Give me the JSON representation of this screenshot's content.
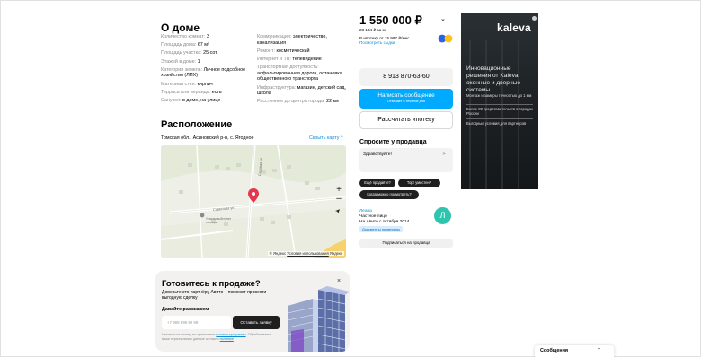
{
  "about": {
    "title": "О доме",
    "left_params": [
      {
        "k": "Количество комнат:",
        "v": "3"
      },
      {
        "k": "Площадь дома:",
        "v": "67 м²"
      },
      {
        "k": "Площадь участка:",
        "v": "25 сот."
      },
      {
        "k": "Этажей в доме:",
        "v": "1"
      },
      {
        "k": "Категория земель:",
        "v": "Личное подсобное хозяйство (ЛПХ)"
      },
      {
        "k": "Материал стен:",
        "v": "кирпич"
      },
      {
        "k": "Терраса или веранда:",
        "v": "есть"
      },
      {
        "k": "Санузел:",
        "v": "в доме, на улице"
      }
    ],
    "right_params": [
      {
        "k": "Коммуникации:",
        "v": "электричество, канализация"
      },
      {
        "k": "Ремонт:",
        "v": "косметический"
      },
      {
        "k": "Интернет и ТВ:",
        "v": "телевидение"
      },
      {
        "k": "Транспортная доступность:",
        "v": "асфальтированная дорога, остановка общественного транспорта"
      },
      {
        "k": "Инфраструктура:",
        "v": "магазин, детский сад, школа"
      },
      {
        "k": "Расстояние до центра города:",
        "v": "22 км"
      }
    ]
  },
  "location": {
    "title": "Расположение",
    "address": "Томская обл., Асиновский р-н, с. Ягодное",
    "hide_map": "Скрыть карту ^",
    "map_labels": {
      "street1": "Садовая ул.",
      "street2": "Советская ул.",
      "poi": "Участковый пункт полиции"
    },
    "zoom_in": "+",
    "zoom_out": "–",
    "locate": "➤",
    "footer_brand": "© Яндекс",
    "footer_terms": "Условия использования",
    "footer_logo": "Яндекс"
  },
  "promo": {
    "title": "Готовитесь к продаже?",
    "subtitle": "Доверьте это партнёру Авито – поможет провести выгодную сделку",
    "question": "Давайте расскажем",
    "phone_placeholder": "+7 999 999 99 99",
    "button": "Оставить заявку",
    "legal_prefix": "Нажимая на кнопку, вы принимаете ",
    "legal_link1": "условия программы",
    "legal_mid": ". Обрабатываем ваши персональные данные согласно ",
    "legal_link2": "политике",
    "close": "×"
  },
  "offer": {
    "price": "1 550 000 ₽",
    "price_chevron": "⌄",
    "per_m2": "23 134 ₽ за м²",
    "mortgage": "В ипотеку от 15 997 ₽/мес",
    "show_offers": "Посмотреть сыдки",
    "phone": "8 913 870-63-60",
    "write_l1": "Написать сообщение",
    "write_l2": "Отвечает в течение дня",
    "calc_mortgage": "Рассчитать ипотеку"
  },
  "ask": {
    "title": "Спросите у продавца",
    "input_value": "Здравствуйте!",
    "send": "➤",
    "chips": [
      "Ещё продаёте?",
      "Торг уместен?",
      "Когда можно посмотреть?"
    ]
  },
  "seller": {
    "name": "Леана",
    "type": "Частное лицо",
    "since": "На Авито с октября 2014",
    "docs": "Документы проверены",
    "avatar_letter": "Л",
    "subscribe": "Подписаться на продавца"
  },
  "ad": {
    "logo": "kaleva",
    "headline": "Инновационные решения от Kaleva: оконные и дверные системы",
    "bullets": [
      "Монтаж и замеры точностью до 1 мм",
      "Более 80 представительств в городах России",
      "Выгодные условия для партнёров"
    ]
  },
  "messages": {
    "label": "Сообщения",
    "chevron": "⌃"
  },
  "colors": {
    "accent_blue": "#00aaff",
    "link_blue": "#0a8fd4",
    "dark": "#1f1f1f",
    "avatar": "#2ec4ad",
    "ad_bg": "#1e2124"
  }
}
